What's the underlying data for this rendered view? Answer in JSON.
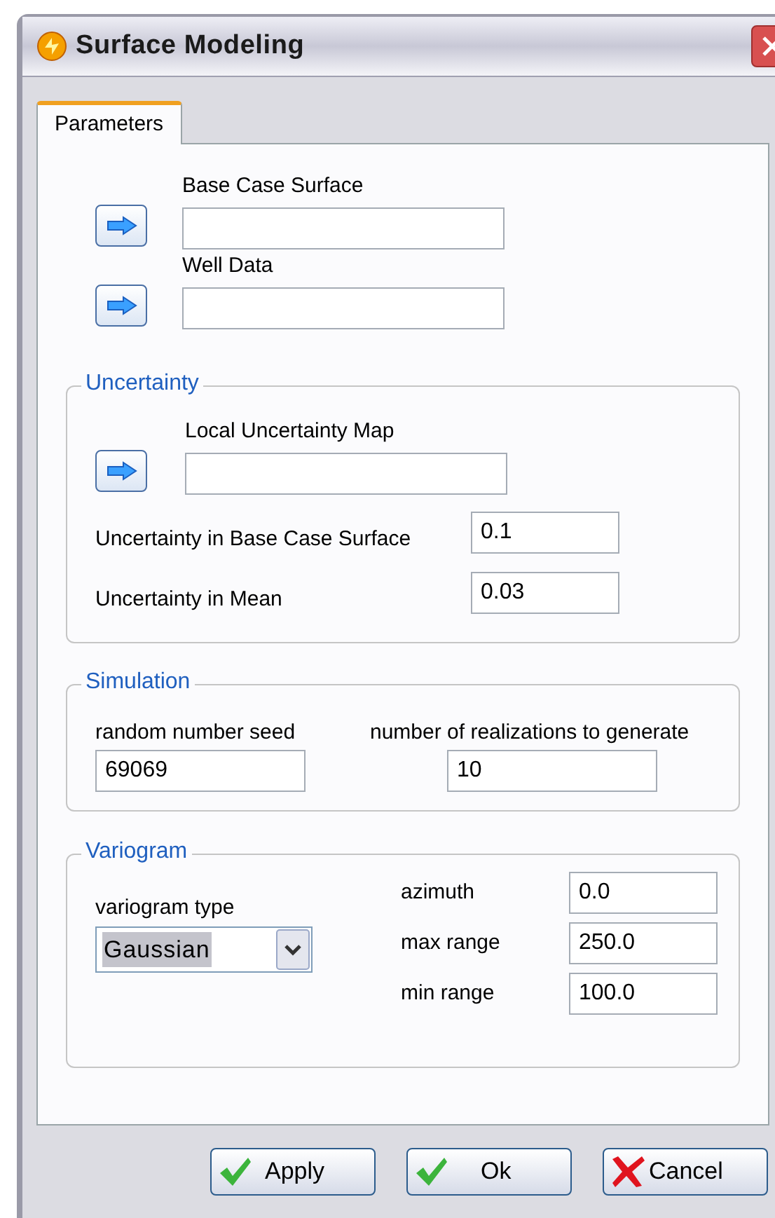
{
  "window": {
    "title": "Surface Modeling"
  },
  "tabs": [
    {
      "label": "Parameters",
      "selected": true
    }
  ],
  "inputs": [
    {
      "label": "Base Case Surface"
    },
    {
      "label": "Well Data"
    }
  ],
  "uncertainty": {
    "title": "Uncertainty",
    "map": {
      "label": "Local Uncertainty Map"
    },
    "fields": [
      {
        "label": "Uncertainty in Base Case Surface",
        "value": "0.1"
      },
      {
        "label": "Uncertainty in Mean",
        "value": "0.03"
      }
    ]
  },
  "simulation": {
    "title": "Simulation",
    "fields": [
      {
        "label": "random number seed",
        "value": "69069"
      },
      {
        "label": "number of realizations to generate",
        "value": "10"
      }
    ]
  },
  "variogram": {
    "title": "Variogram",
    "type": {
      "label": "variogram type",
      "value": "Gaussian"
    },
    "fields": [
      {
        "label": "azimuth",
        "value": "0.0"
      },
      {
        "label": "max range",
        "value": "250.0"
      },
      {
        "label": "min range",
        "value": "100.0"
      }
    ]
  },
  "buttons": [
    {
      "label": "Apply",
      "kind": "check"
    },
    {
      "label": "Ok",
      "kind": "check"
    },
    {
      "label": "Cancel",
      "kind": "cross"
    }
  ]
}
